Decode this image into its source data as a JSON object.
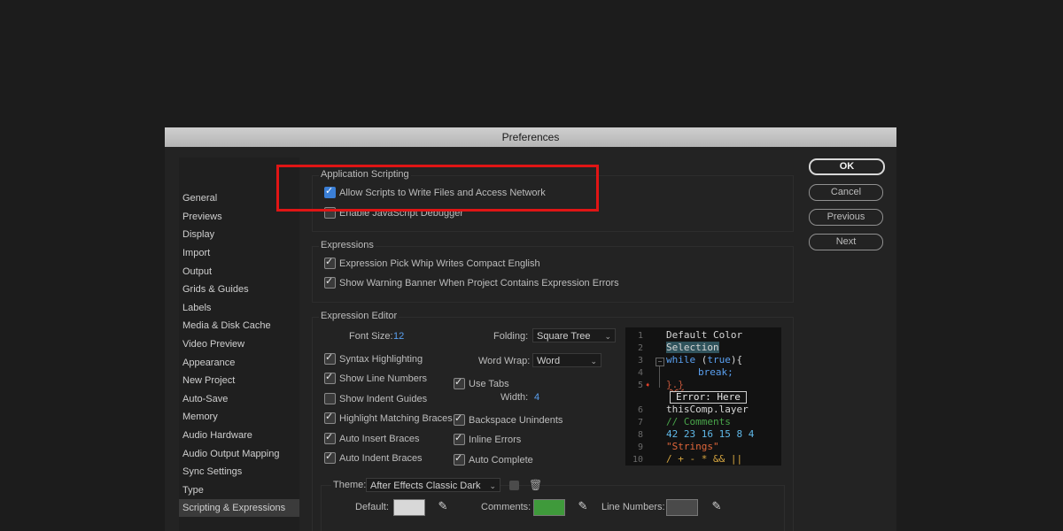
{
  "window": {
    "title": "Preferences"
  },
  "sidebar": {
    "items": [
      {
        "label": "General"
      },
      {
        "label": "Previews"
      },
      {
        "label": "Display"
      },
      {
        "label": "Import"
      },
      {
        "label": "Output"
      },
      {
        "label": "Grids & Guides"
      },
      {
        "label": "Labels"
      },
      {
        "label": "Media & Disk Cache"
      },
      {
        "label": "Video Preview"
      },
      {
        "label": "Appearance"
      },
      {
        "label": "New Project"
      },
      {
        "label": "Auto-Save"
      },
      {
        "label": "Memory"
      },
      {
        "label": "Audio Hardware"
      },
      {
        "label": "Audio Output Mapping"
      },
      {
        "label": "Sync Settings"
      },
      {
        "label": "Type"
      },
      {
        "label": "Scripting & Expressions"
      }
    ],
    "selected": "Scripting & Expressions"
  },
  "buttons": {
    "ok": "OK",
    "cancel": "Cancel",
    "previous": "Previous",
    "next": "Next"
  },
  "app_scripting": {
    "title": "Application Scripting",
    "allow_scripts": {
      "label": "Allow Scripts to Write Files and Access Network",
      "checked": true
    },
    "js_debugger": {
      "label": "Enable JavaScript Debugger",
      "checked": false
    }
  },
  "expressions": {
    "title": "Expressions",
    "pick_whip": {
      "label": "Expression Pick Whip Writes Compact English",
      "checked": true
    },
    "warning_banner": {
      "label": "Show Warning Banner When Project Contains Expression Errors",
      "checked": true
    }
  },
  "editor": {
    "title": "Expression Editor",
    "font_size_label": "Font Size:",
    "font_size": "12",
    "folding_label": "Folding:",
    "folding": "Square Tree",
    "word_wrap_label": "Word Wrap:",
    "word_wrap": "Word",
    "syntax_highlighting": {
      "label": "Syntax Highlighting",
      "checked": true
    },
    "show_line_numbers": {
      "label": "Show Line Numbers",
      "checked": true
    },
    "show_indent_guides": {
      "label": "Show Indent Guides",
      "checked": false
    },
    "highlight_braces": {
      "label": "Highlight Matching Braces",
      "checked": true
    },
    "auto_insert_braces": {
      "label": "Auto Insert Braces",
      "checked": true
    },
    "auto_indent_braces": {
      "label": "Auto Indent Braces",
      "checked": true
    },
    "use_tabs": {
      "label": "Use Tabs",
      "checked": true
    },
    "width_label": "Width:",
    "width": "4",
    "backspace_unindents": {
      "label": "Backspace Unindents",
      "checked": true
    },
    "inline_errors": {
      "label": "Inline Errors",
      "checked": true
    },
    "auto_complete": {
      "label": "Auto Complete",
      "checked": true
    },
    "preview": {
      "line_numbers": [
        "1",
        "2",
        "3",
        "4",
        "5",
        "6",
        "7",
        "8",
        "9",
        "10"
      ],
      "default_color": "Default Color",
      "selection": "Selection",
      "kw_while": "while",
      "paren_open": " (",
      "kw_true": "true",
      "paren_close": "){",
      "kw_break": "break;",
      "brace_close": "}.}",
      "error": "Error: Here",
      "this_comp": "thisComp.layer",
      "comments": "// Comments",
      "numbers": "42 23 16 15 8 4",
      "strings": "\"Strings\"",
      "operators": "/ + - * && ||"
    },
    "theme_label": "Theme:",
    "theme": "After Effects Classic Dark",
    "colors": {
      "default_label": "Default:",
      "default_color": "#d8d8d8",
      "comments_label": "Comments:",
      "comments_color": "#3f9a3b",
      "line_numbers_label": "Line Numbers:",
      "line_numbers_color": "#4a4a4a"
    }
  },
  "colors": {
    "accent": "#3b7fd6",
    "highlight": "#e01515"
  }
}
